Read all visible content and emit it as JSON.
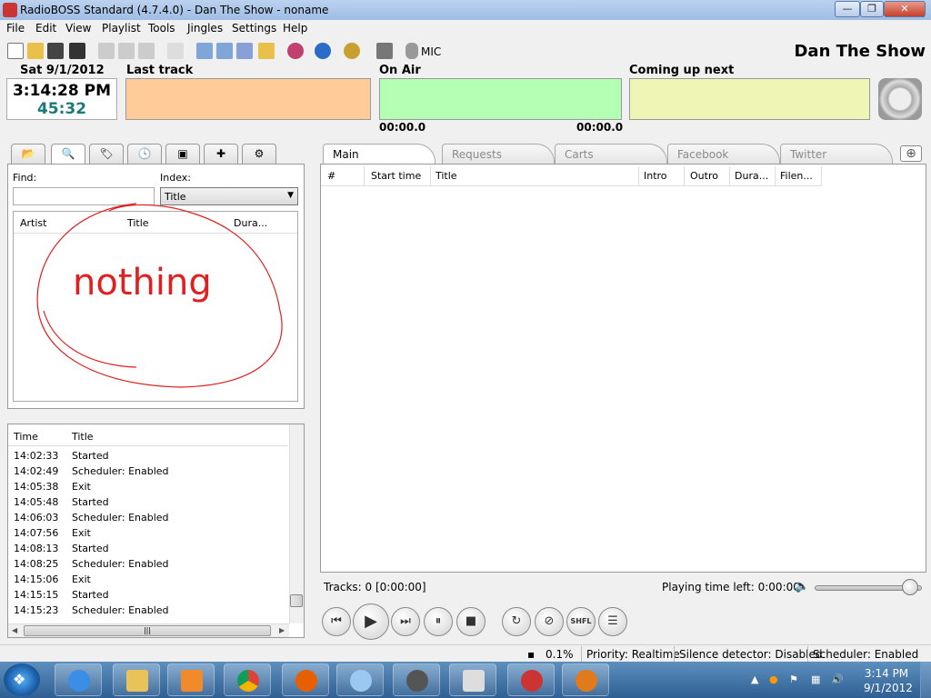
{
  "window": {
    "title": "RadioBOSS Standard (4.7.4.0) - Dan The Show - noname",
    "buttons": {
      "minimize": "—",
      "maximize": "❐",
      "close": "✕"
    }
  },
  "menu": [
    "File",
    "Edit",
    "View",
    "Playlist",
    "Tools",
    "Jingles",
    "Settings",
    "Help"
  ],
  "toolbar": {
    "mic_label": "MIC",
    "show_title": "Dan The Show",
    "icons": [
      "new-file-icon",
      "open-folder-icon",
      "save-icon",
      "save-all-icon",
      "cut-icon",
      "copy-icon",
      "paste-icon",
      "undo-icon",
      "insert-track-icon",
      "insert-file-icon",
      "insert-list-icon",
      "insert-folder-icon",
      "eq-icon",
      "globe-icon",
      "settings-gear-icon",
      "scheduler-icon",
      "mic-icon"
    ]
  },
  "clock": {
    "date": "Sat 9/1/2012",
    "time": "3:14:28 PM",
    "countdown": "45:32"
  },
  "panels": {
    "last_track": "Last track",
    "on_air": "On Air",
    "coming_up": "Coming up next",
    "on_air_elapsed": "00:00.0",
    "on_air_remaining": "00:00.0",
    "colors": {
      "last_track": "#ffcc99",
      "on_air": "#b3ffb3",
      "coming_up": "#eef5b5"
    }
  },
  "search": {
    "find_label": "Find:",
    "find_value": "",
    "index_label": "Index:",
    "index_value": "Title",
    "columns": [
      "Artist",
      "Title",
      "Dura..."
    ],
    "annotation": "nothing"
  },
  "log": {
    "columns": [
      "Time",
      "Title"
    ],
    "rows": [
      {
        "time": "14:02:33",
        "title": "Started"
      },
      {
        "time": "14:02:49",
        "title": "Scheduler: Enabled"
      },
      {
        "time": "14:05:38",
        "title": "Exit"
      },
      {
        "time": "14:05:48",
        "title": "Started"
      },
      {
        "time": "14:06:03",
        "title": "Scheduler: Enabled"
      },
      {
        "time": "14:07:56",
        "title": "Exit"
      },
      {
        "time": "14:08:13",
        "title": "Started"
      },
      {
        "time": "14:08:25",
        "title": "Scheduler: Enabled"
      },
      {
        "time": "14:15:06",
        "title": "Exit"
      },
      {
        "time": "14:15:15",
        "title": "Started"
      },
      {
        "time": "14:15:23",
        "title": "Scheduler: Enabled"
      }
    ]
  },
  "playlist_tabs": [
    "Main",
    "Requests",
    "Carts",
    "Facebook",
    "Twitter"
  ],
  "playlist": {
    "columns": [
      "#",
      "Start time",
      "Title",
      "Intro",
      "Outro",
      "Dura...",
      "Filen..."
    ]
  },
  "status": {
    "tracks": "Tracks: 0 [0:00:00]",
    "playing_time_left": "Playing time left: 0:00:00",
    "volume_level": 0.95,
    "cpu": "0.1%",
    "priority": "Priority: Realtime",
    "silence": "Silence detector: Disabled",
    "scheduler": "Scheduler: Enabled"
  },
  "player_buttons": {
    "prev": "⏮",
    "play": "▶",
    "next": "⏭",
    "pause": "⏸",
    "stop": "■",
    "loop": "↻",
    "block": "⊘",
    "shfl": "SHFL",
    "list": "☰"
  },
  "taskbar": {
    "clock_time": "3:14 PM",
    "clock_date": "9/1/2012",
    "apps": [
      "internet-explorer-icon",
      "file-explorer-icon",
      "media-player-icon",
      "chrome-icon",
      "firefox-icon",
      "paint-icon",
      "itunes-icon",
      "video-editor-icon",
      "radioboss-icon",
      "game-icon"
    ]
  }
}
